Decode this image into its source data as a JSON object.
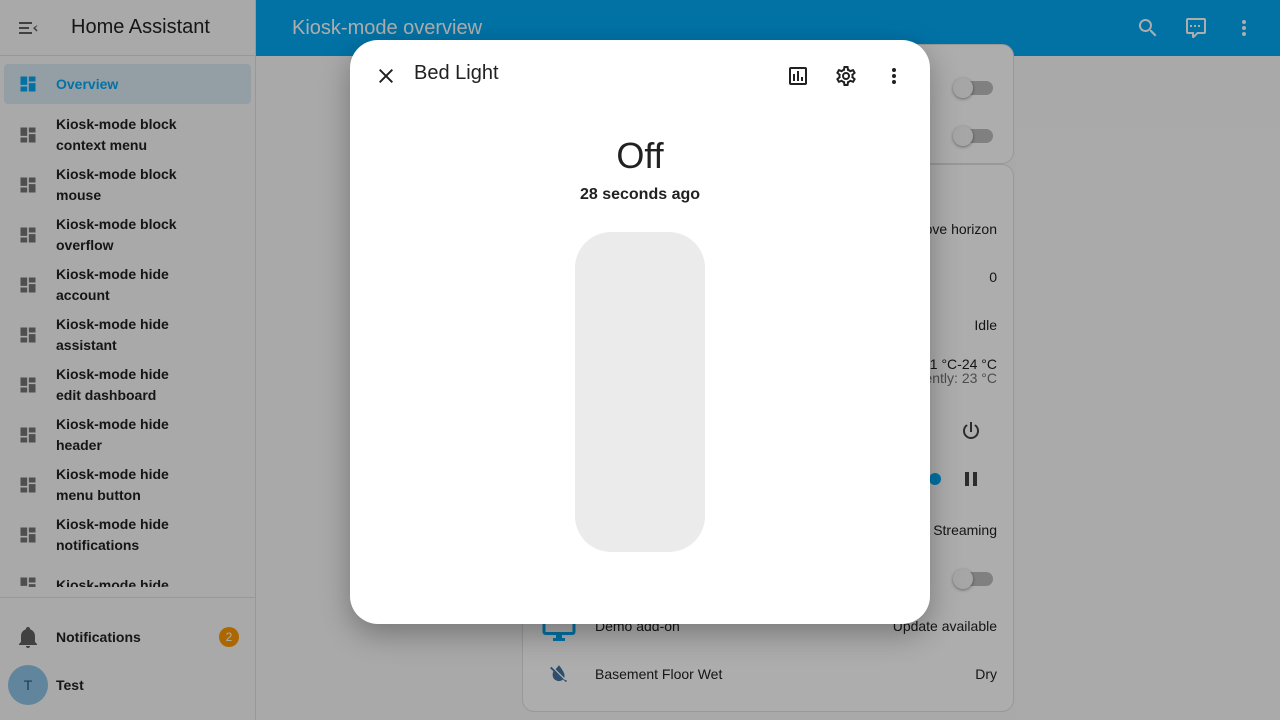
{
  "app": {
    "title": "Home Assistant"
  },
  "sidebar": {
    "items": [
      {
        "label": "Overview"
      },
      {
        "label": "Kiosk-mode block context menu"
      },
      {
        "label": "Kiosk-mode block mouse"
      },
      {
        "label": "Kiosk-mode block overflow"
      },
      {
        "label": "Kiosk-mode hide account"
      },
      {
        "label": "Kiosk-mode hide assistant"
      },
      {
        "label": "Kiosk-mode hide edit dashboard"
      },
      {
        "label": "Kiosk-mode hide header"
      },
      {
        "label": "Kiosk-mode hide menu button"
      },
      {
        "label": "Kiosk-mode hide notifications"
      },
      {
        "label": "Kiosk-mode hide ..."
      }
    ],
    "notifications": {
      "label": "Notifications",
      "count": "2"
    },
    "user": {
      "initial": "T",
      "name": "Test"
    }
  },
  "topbar": {
    "title": "Kiosk-mode overview"
  },
  "background_card": {
    "rows": [
      {
        "state": "ove horizon"
      },
      {
        "state": "0"
      },
      {
        "state": "Idle"
      },
      {
        "state": "21 °C-24 °C",
        "secondary": "ently: 23 °C"
      },
      {
        "state": "Streaming"
      },
      {
        "name": "Demo add-on",
        "state": "Update available"
      },
      {
        "name": "Basement Floor Wet",
        "state": "Dry"
      }
    ]
  },
  "dialog": {
    "title": "Bed Light",
    "state": "Off",
    "last_changed": "28 seconds ago"
  },
  "colors": {
    "primary": "#03a9f4",
    "badge": "#ff9800"
  }
}
